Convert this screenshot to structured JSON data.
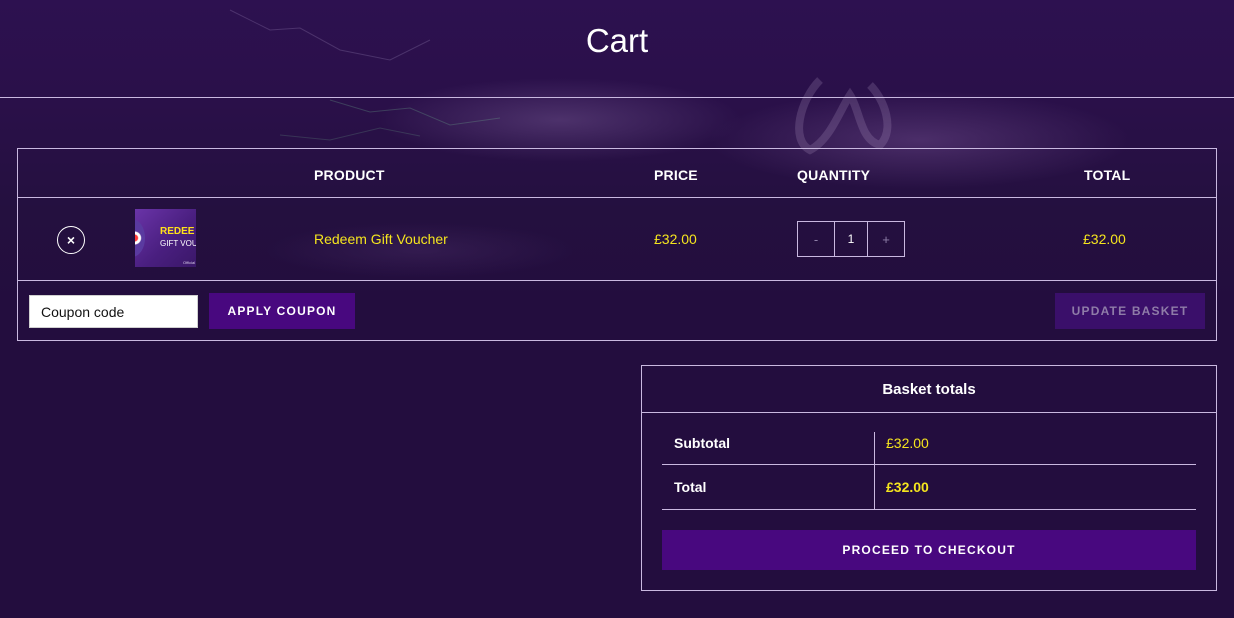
{
  "page": {
    "title": "Cart"
  },
  "cart_table": {
    "headers": {
      "product": "PRODUCT",
      "price": "PRICE",
      "quantity": "QUANTITY",
      "total": "TOTAL"
    },
    "items": [
      {
        "remove_symbol": "×",
        "thumbnail": {
          "line1": "REDEE",
          "line2": "GIFT VOU",
          "line3": "Official"
        },
        "name": "Redeem Gift Voucher",
        "price": "£32.00",
        "quantity": {
          "minus": "-",
          "value": "1",
          "plus": "+"
        },
        "total": "£32.00"
      }
    ],
    "actions": {
      "coupon_placeholder": "Coupon code",
      "apply_label": "APPLY COUPON",
      "update_label": "UPDATE BASKET"
    }
  },
  "totals": {
    "heading": "Basket totals",
    "subtotal_label": "Subtotal",
    "subtotal_value": "£32.00",
    "total_label": "Total",
    "total_value": "£32.00",
    "checkout_label": "PROCEED TO CHECKOUT"
  },
  "colors": {
    "background": "#230d3e",
    "accent_button": "#48087f",
    "price_text": "#f5e51e",
    "border": "#c9b8e0"
  },
  "icons": {
    "remove": "close-circle-icon"
  }
}
